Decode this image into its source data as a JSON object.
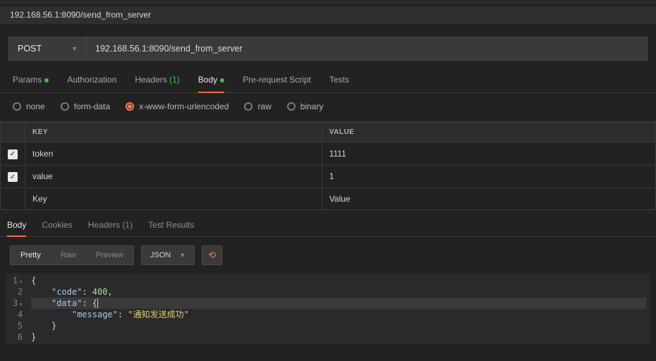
{
  "tabTitle": "192.168.56.1:8090/send_from_server",
  "request": {
    "method": "POST",
    "url": "192.168.56.1:8090/send_from_server"
  },
  "reqTabs": {
    "params": "Params",
    "auth": "Authorization",
    "headers": "Headers",
    "headersCount": "(1)",
    "body": "Body",
    "preReq": "Pre-request Script",
    "tests": "Tests"
  },
  "bodyTypes": {
    "none": "none",
    "formData": "form-data",
    "urlenc": "x-www-form-urlencoded",
    "raw": "raw",
    "binary": "binary"
  },
  "kvHeaders": {
    "key": "KEY",
    "value": "VALUE"
  },
  "params": [
    {
      "checked": true,
      "key": "token",
      "value": "1111"
    },
    {
      "checked": true,
      "key": "value",
      "value": "1"
    }
  ],
  "kvPlaceholder": {
    "key": "Key",
    "value": "Value"
  },
  "respTabs": {
    "body": "Body",
    "cookies": "Cookies",
    "headers": "Headers",
    "headersCount": "(1)",
    "testResults": "Test Results"
  },
  "viewModes": {
    "pretty": "Pretty",
    "raw": "Raw",
    "preview": "Preview"
  },
  "format": "JSON",
  "responseLines": [
    "{",
    "    \"code\": 400,",
    "    \"data\": {|",
    "        \"message\": \"通知发送成功\"",
    "    }",
    "}"
  ]
}
